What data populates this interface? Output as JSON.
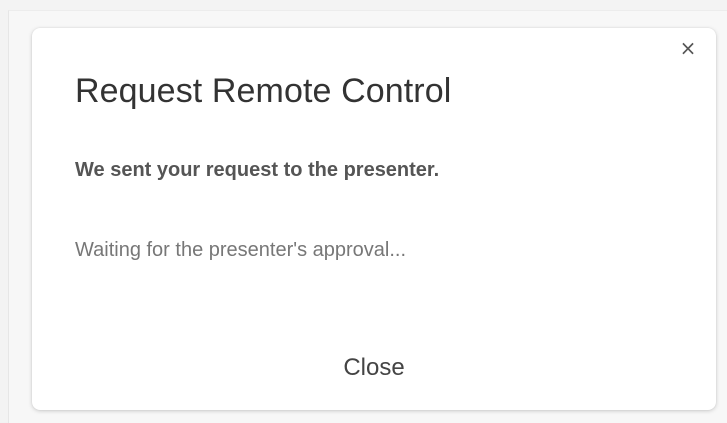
{
  "dialog": {
    "title": "Request Remote Control",
    "message": "We sent your request to the presenter.",
    "status": "Waiting for the presenter's approval...",
    "close_label": "Close",
    "close_icon": "×"
  },
  "colors": {
    "background": "#f3f3f3",
    "dialog_bg": "#ffffff",
    "title": "#333333",
    "message": "#555555",
    "status": "#777777"
  },
  "icons": {
    "close": "close-icon"
  }
}
